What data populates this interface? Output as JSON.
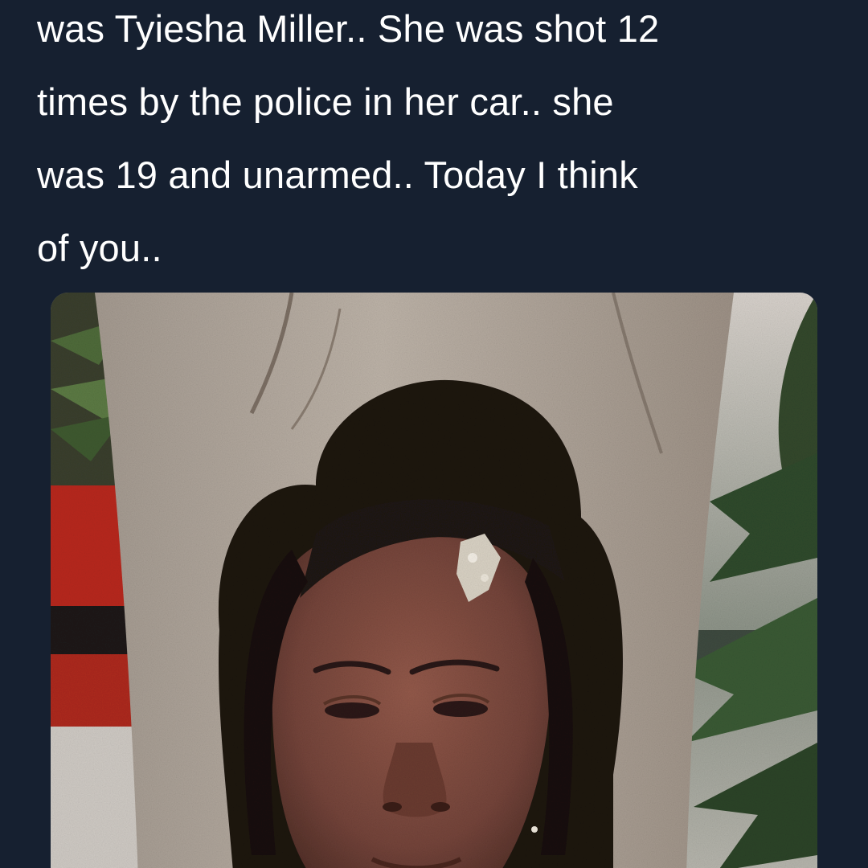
{
  "tweet": {
    "text_lines": [
      "was Tyiesha Miller.. She was shot 12",
      "times by the police in her car.. she",
      "was 19 and unarmed.. Today I think",
      "of you.."
    ]
  },
  "media": {
    "icon": "portrait-photo",
    "colors": {
      "background": "#162030",
      "text": "#ffffff",
      "tree_trunk": "#b5aba0",
      "hair": "#1c1412",
      "skin": "#7e4b3c",
      "foliage": "#2f4a2c",
      "red_wall": "#b8281d"
    }
  }
}
